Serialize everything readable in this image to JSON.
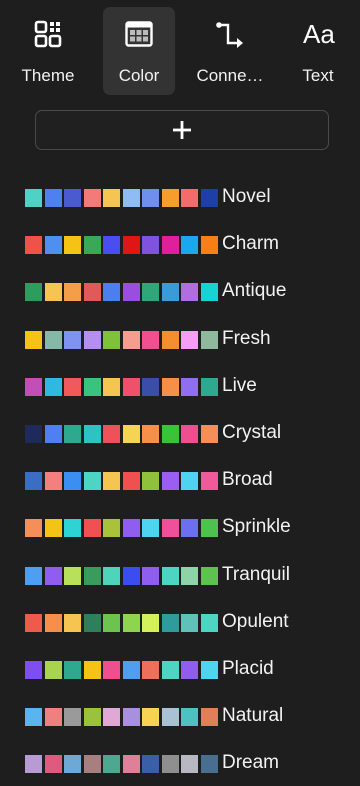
{
  "tabs": [
    {
      "label": "Theme",
      "icon": "theme-grid-icon",
      "active": false
    },
    {
      "label": "Color",
      "icon": "color-grid-icon",
      "active": true
    },
    {
      "label": "Conne…",
      "icon": "connector-icon",
      "active": false
    },
    {
      "label": "Text",
      "icon": "text-icon",
      "active": false
    }
  ],
  "text_icon_glyph": "Aa",
  "add_button": {
    "icon": "plus-icon"
  },
  "palettes": [
    {
      "name": "Novel",
      "colors": [
        "#4fd1c5",
        "#4f7ff0",
        "#4a5bd1",
        "#f47a7a",
        "#f5c451",
        "#8fbcf5",
        "#6f8ff0",
        "#f59e2e",
        "#f46b6b",
        "#1e3fa8"
      ]
    },
    {
      "name": "Charm",
      "colors": [
        "#f0514b",
        "#4f8ff0",
        "#f5c216",
        "#3aa856",
        "#4a4ef0",
        "#e01616",
        "#7f53e0",
        "#e0209b",
        "#1aa7f0",
        "#f77f16"
      ]
    },
    {
      "name": "Antique",
      "colors": [
        "#2e9c5c",
        "#f5c451",
        "#f59e4a",
        "#e05a5a",
        "#4a7ff0",
        "#9a4ee0",
        "#2ea87a",
        "#3a9bd9",
        "#b06ee0",
        "#16d4d4"
      ]
    },
    {
      "name": "Fresh",
      "colors": [
        "#f5c216",
        "#86b8a8",
        "#7f93f0",
        "#b58ff0",
        "#7fc23a",
        "#f59e8f",
        "#f0508f",
        "#f58e2e",
        "#f59ef5",
        "#8fb89c"
      ]
    },
    {
      "name": "Live",
      "colors": [
        "#c24fb8",
        "#2fb8e0",
        "#f05a5a",
        "#3ac27f",
        "#f5c451",
        "#f0506b",
        "#3a4ea8",
        "#f58f4a",
        "#8f6ef0",
        "#2ea88f"
      ]
    },
    {
      "name": "Crystal",
      "colors": [
        "#1e2a5c",
        "#4f7ff0",
        "#2ea88f",
        "#2ec2c2",
        "#f0505a",
        "#f5d451",
        "#f58f4a",
        "#3ac23a",
        "#f04f8f",
        "#f58f5a"
      ]
    },
    {
      "name": "Broad",
      "colors": [
        "#3a6ec2",
        "#f57f7f",
        "#3a8ff0",
        "#4ed4c2",
        "#f5c451",
        "#f05050",
        "#8fc23a",
        "#9a5ef0",
        "#4ed4f0",
        "#f05a9a"
      ]
    },
    {
      "name": "Sprinkle",
      "colors": [
        "#f58f5a",
        "#f5c216",
        "#2ed4d4",
        "#f05050",
        "#a8c23a",
        "#8f5ef0",
        "#4ed4f0",
        "#f04f9a",
        "#6e6ef0",
        "#4ec24e"
      ]
    },
    {
      "name": "Tranquil",
      "colors": [
        "#4f9ff0",
        "#8f5ef0",
        "#b8e05a",
        "#3a9c5c",
        "#4ed4b8",
        "#3a4ef0",
        "#8f5ef0",
        "#4ed4c2",
        "#8fd4a8",
        "#5ec24e"
      ]
    },
    {
      "name": "Opulent",
      "colors": [
        "#f05a4a",
        "#f58f4a",
        "#f5c451",
        "#2e7f5c",
        "#6ec24e",
        "#8fd44e",
        "#d4f05a",
        "#2e9c9c",
        "#5ec2b8",
        "#4ed4c2"
      ]
    },
    {
      "name": "Placid",
      "colors": [
        "#7f4ef0",
        "#a8d44e",
        "#2ea88f",
        "#f5c216",
        "#f04f8f",
        "#4f9ff0",
        "#f06e5a",
        "#4ed4c2",
        "#8f5ef0",
        "#4ed4f0"
      ]
    },
    {
      "name": "Natural",
      "colors": [
        "#5ab4f0",
        "#f07f7f",
        "#9a9a9a",
        "#9ac23a",
        "#e0a8d4",
        "#a88fe0",
        "#f5d451",
        "#a8c2d4",
        "#4ec2c2",
        "#e07f5a"
      ]
    },
    {
      "name": "Dream",
      "colors": [
        "#b89ad4",
        "#e05a7f",
        "#6ea8d4",
        "#a87f7f",
        "#4ea88f",
        "#e07f9a",
        "#3a5ea8",
        "#8f8f8f",
        "#b8b8c2",
        "#4a6e8f"
      ]
    }
  ]
}
